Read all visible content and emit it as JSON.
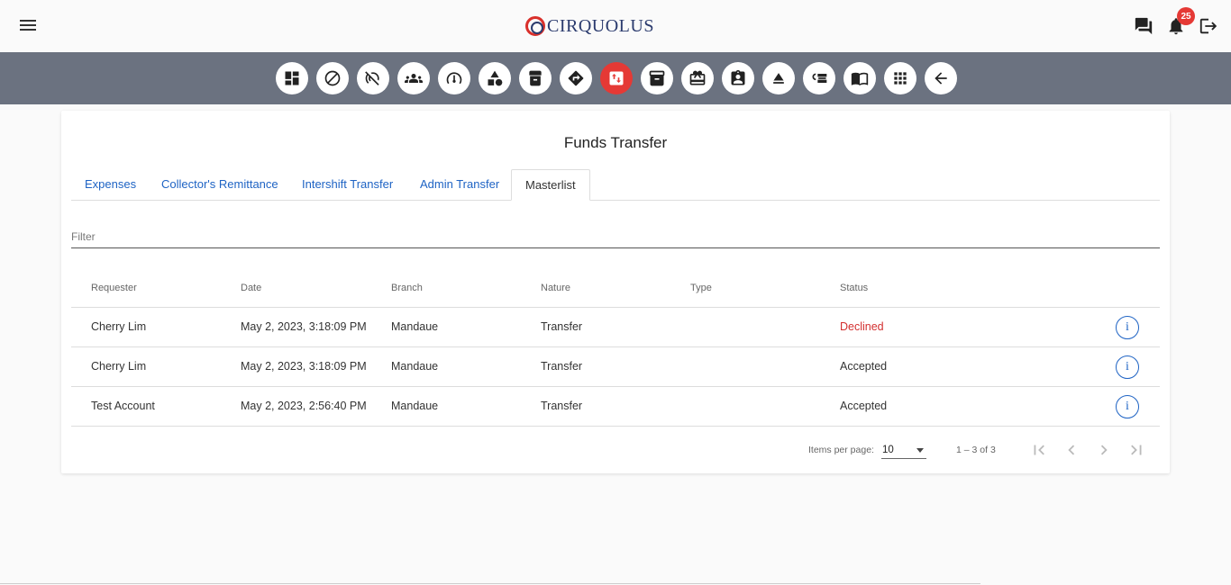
{
  "header": {
    "brand": "CIRQUOLUS",
    "notification_count": "25",
    "icons": [
      "menu-icon",
      "chat-icon",
      "bell-icon",
      "logout-icon"
    ]
  },
  "toolbar": {
    "buttons": [
      {
        "name": "dashboard-icon"
      },
      {
        "name": "block-icon"
      },
      {
        "name": "no-signal-icon"
      },
      {
        "name": "group-icon"
      },
      {
        "name": "speedometer-icon"
      },
      {
        "name": "shapes-icon"
      },
      {
        "name": "archive-box-icon"
      },
      {
        "name": "directions-icon"
      },
      {
        "name": "funds-transfer-icon",
        "active": true
      },
      {
        "name": "inventory-icon"
      },
      {
        "name": "card-giftcard-icon"
      },
      {
        "name": "clipboard-user-icon"
      },
      {
        "name": "eject-icon"
      },
      {
        "name": "checklist-icon"
      },
      {
        "name": "book-icon"
      },
      {
        "name": "apps-grid-icon"
      },
      {
        "name": "back-arrow-icon"
      }
    ],
    "active_color": "#e53935"
  },
  "page": {
    "title": "Funds Transfer",
    "tabs": [
      "Expenses",
      "Collector's Remittance",
      "Intershift Transfer",
      "Admin Transfer",
      "Masterlist"
    ],
    "active_tab": "Masterlist",
    "filter_placeholder": "Filter"
  },
  "table": {
    "columns": [
      "Requester",
      "Date",
      "Branch",
      "Nature",
      "Type",
      "Status"
    ],
    "rows": [
      {
        "requester": "Cherry Lim",
        "date": "May 2, 2023, 3:18:09 PM",
        "branch": "Mandaue",
        "nature": "Transfer",
        "type": "",
        "status": "Declined"
      },
      {
        "requester": "Cherry Lim",
        "date": "May 2, 2023, 3:18:09 PM",
        "branch": "Mandaue",
        "nature": "Transfer",
        "type": "",
        "status": "Accepted"
      },
      {
        "requester": "Test Account",
        "date": "May 2, 2023, 2:56:40 PM",
        "branch": "Mandaue",
        "nature": "Transfer",
        "type": "",
        "status": "Accepted"
      }
    ],
    "info_label": "i",
    "status_colors": {
      "Declined": "#d32f2f",
      "Accepted": "#333333"
    }
  },
  "paginator": {
    "items_per_page_label": "Items per page:",
    "items_per_page_value": "10",
    "range_label": "1 – 3 of 3"
  }
}
